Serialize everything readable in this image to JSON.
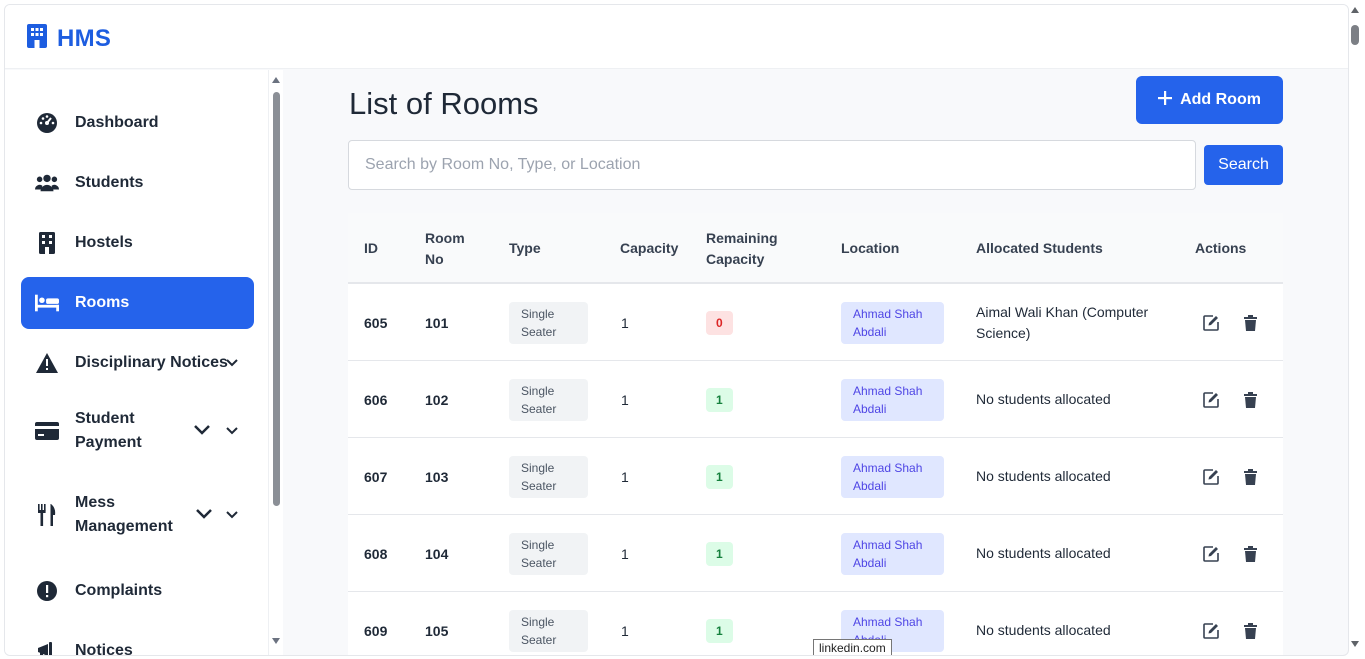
{
  "app": {
    "name": "HMS",
    "accent": "#2563eb"
  },
  "sidebar": {
    "items": [
      {
        "label": "Dashboard",
        "icon": "gauge-icon"
      },
      {
        "label": "Students",
        "icon": "users-icon"
      },
      {
        "label": "Hostels",
        "icon": "building-icon"
      },
      {
        "label": "Rooms",
        "icon": "bed-icon",
        "active": true
      },
      {
        "label": "Disciplinary Notices",
        "icon": "warning-icon"
      },
      {
        "label": "Student Payment",
        "icon": "credit-card-icon"
      },
      {
        "label": "Mess Management",
        "icon": "utensils-icon"
      },
      {
        "label": "Complaints",
        "icon": "exclamation-circle-icon"
      },
      {
        "label": "Notices",
        "icon": "megaphone-icon"
      }
    ]
  },
  "main": {
    "title": "List of Rooms",
    "add_button": "Add Room",
    "search_placeholder": "Search by Room No, Type, or Location",
    "search_button": "Search"
  },
  "table": {
    "headers": [
      "ID",
      "Room No",
      "Type",
      "Capacity",
      "Remaining Capacity",
      "Location",
      "Allocated Students",
      "Actions"
    ],
    "rows": [
      {
        "id": "605",
        "room": "101",
        "type": "Single Seater",
        "capacity": "1",
        "remaining": "0",
        "location": "Ahmad Shah Abdali",
        "allocated": "Aimal Wali Khan (Computer Science)"
      },
      {
        "id": "606",
        "room": "102",
        "type": "Single Seater",
        "capacity": "1",
        "remaining": "1",
        "location": "Ahmad Shah Abdali",
        "allocated": "No students allocated"
      },
      {
        "id": "607",
        "room": "103",
        "type": "Single Seater",
        "capacity": "1",
        "remaining": "1",
        "location": "Ahmad Shah Abdali",
        "allocated": "No students allocated"
      },
      {
        "id": "608",
        "room": "104",
        "type": "Single Seater",
        "capacity": "1",
        "remaining": "1",
        "location": "Ahmad Shah Abdali",
        "allocated": "No students allocated"
      },
      {
        "id": "609",
        "room": "105",
        "type": "Single Seater",
        "capacity": "1",
        "remaining": "1",
        "location": "Ahmad Shah Abdali",
        "allocated": "No students allocated"
      }
    ]
  },
  "tooltip": "linkedin.com"
}
